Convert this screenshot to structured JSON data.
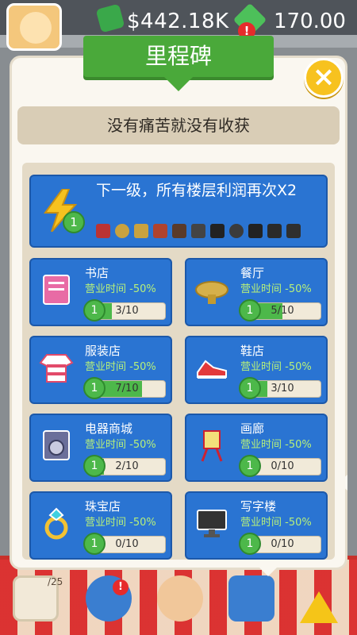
{
  "hud": {
    "money": "$442.18K",
    "gems": "170.00",
    "gem_badge": "!",
    "bottom_badge": "!",
    "bottom_date": "/25"
  },
  "milestone": {
    "title": "里程碑",
    "close_label": "×",
    "subtitle": "没有痛苦就没有收获",
    "top_reward": {
      "text": "下一级，所有楼层利润再次X2",
      "level": "1"
    },
    "shops": [
      {
        "name": "书店",
        "desc": "营业时间 -50%",
        "level": "1",
        "progress": "3/10",
        "fraction": 0.3
      },
      {
        "name": "餐厅",
        "desc": "营业时间 -50%",
        "level": "1",
        "progress": "5/10",
        "fraction": 0.5
      },
      {
        "name": "服装店",
        "desc": "营业时间 -50%",
        "level": "1",
        "progress": "7/10",
        "fraction": 0.7
      },
      {
        "name": "鞋店",
        "desc": "营业时间 -50%",
        "level": "1",
        "progress": "3/10",
        "fraction": 0.3
      },
      {
        "name": "电器商城",
        "desc": "营业时间 -50%",
        "level": "1",
        "progress": "2/10",
        "fraction": 0.2
      },
      {
        "name": "画廊",
        "desc": "营业时间 -50%",
        "level": "1",
        "progress": "0/10",
        "fraction": 0.0
      },
      {
        "name": "珠宝店",
        "desc": "营业时间 -50%",
        "level": "1",
        "progress": "0/10",
        "fraction": 0.0
      },
      {
        "name": "写字楼",
        "desc": "营业时间 -50%",
        "level": "1",
        "progress": "0/10",
        "fraction": 0.0
      }
    ]
  },
  "colors": {
    "card_blue": "#2a74d2",
    "accent_green": "#4db84a",
    "desc_green": "#b7f07a",
    "ribbon_green": "#4aa93a",
    "close_yellow": "#f7c21f"
  }
}
